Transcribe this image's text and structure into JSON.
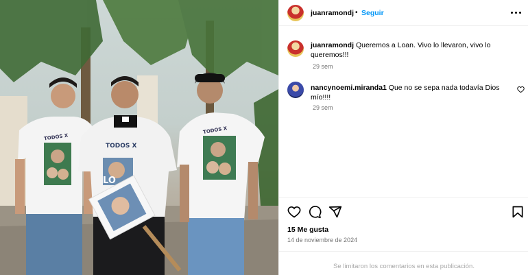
{
  "post": {
    "username": "juanramondj",
    "separator": "•",
    "follow_label": "Seguir",
    "caption_username": "juanramondj",
    "caption_text": "Queremos a Loan. Vivo lo llevaron, vivo lo",
    "caption_text_2": "queremos!!!",
    "caption_time": "29 sem",
    "likes_text": "15 Me gusta",
    "date_text": "14 de noviembre de 2024",
    "comments_limited_text": "Se limitaron los comentarios en esta publicación."
  },
  "comments": [
    {
      "username": "nancynoemi.miranda1",
      "text": "Que no se sepa nada todavía Dios",
      "text_2": "mío!!!!",
      "time": "29 sem"
    }
  ],
  "photo": {
    "shirt_text_left": "TODOS X",
    "shirt_text_center": "TODOS X",
    "shirt_text_right": "TODOS X",
    "sign_text": "LO"
  },
  "icons": {
    "more": "more-options-icon",
    "like": "heart-icon",
    "comment": "comment-icon",
    "share": "share-icon",
    "save": "bookmark-icon"
  },
  "colors": {
    "accent": "#0095f6",
    "muted": "#737373",
    "border": "#efefef"
  }
}
